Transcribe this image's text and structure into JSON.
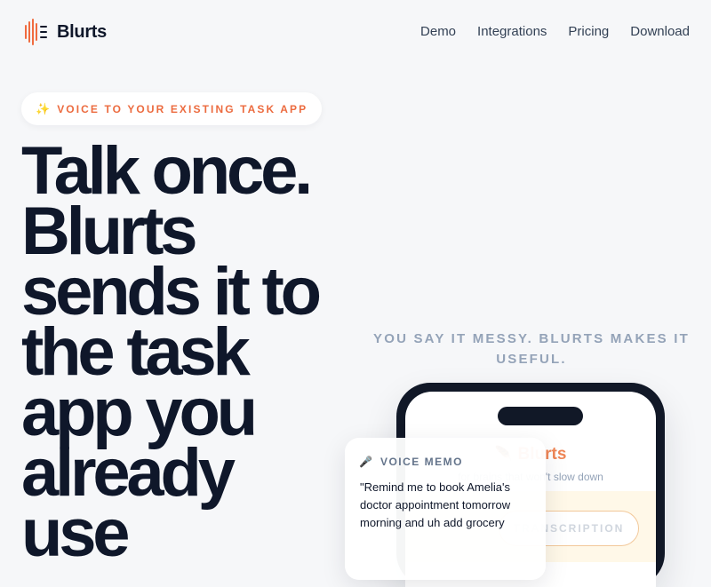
{
  "header": {
    "brand_name": "Blurts",
    "nav": [
      "Demo",
      "Integrations",
      "Pricing",
      "Download"
    ]
  },
  "hero": {
    "badge_icon": "sparkles-icon",
    "badge_text": "VOICE TO YOUR EXISTING TASK APP",
    "title": "Talk once. Blurts sends it to the task app you already use"
  },
  "right": {
    "subtitle": "YOU SAY IT MESSY. BLURTS MAKES IT USEFUL.",
    "phone": {
      "brand_name": "Blurts",
      "tagline": "for brains that won't slow down",
      "transcription_label": "TRANSCRIPTION"
    },
    "memo": {
      "title": "VOICE MEMO",
      "text": "\"Remind me to book Amelia's doctor appointment tomorrow morning and uh add grocery"
    }
  },
  "colors": {
    "background": "#f6f7f9",
    "text": "#0f172a",
    "accent": "#ec6b3f",
    "muted": "#94a3b8"
  }
}
